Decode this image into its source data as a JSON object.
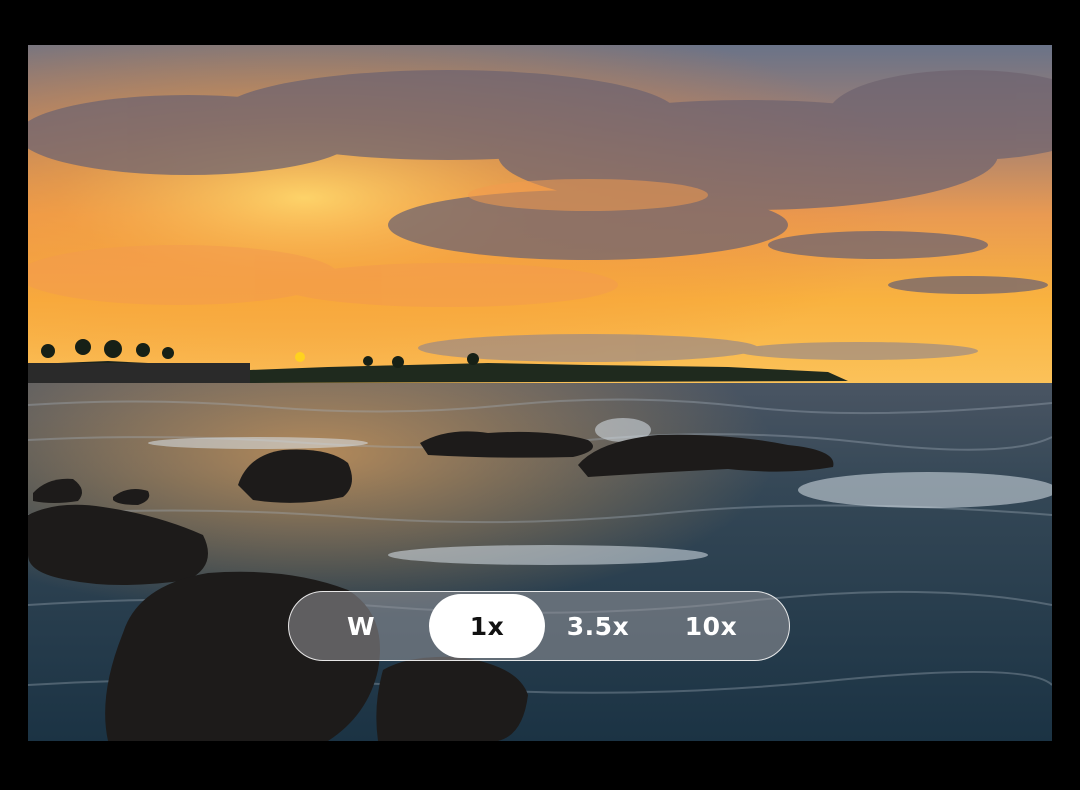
{
  "camera": {
    "zoom_options": [
      {
        "label": "W",
        "selected": false
      },
      {
        "label": "1x",
        "selected": true
      },
      {
        "label": "3.5x",
        "selected": false
      },
      {
        "label": "10x",
        "selected": false
      }
    ]
  },
  "colors": {
    "background": "#000000",
    "selected_pill": "#ffffff",
    "sky_top": "#6d7790",
    "sky_glow": "#f7a33b",
    "sun": "#ffd21f",
    "ocean": "#1f3a4c"
  },
  "icons": {
    "scene": "sunset-seascape"
  }
}
